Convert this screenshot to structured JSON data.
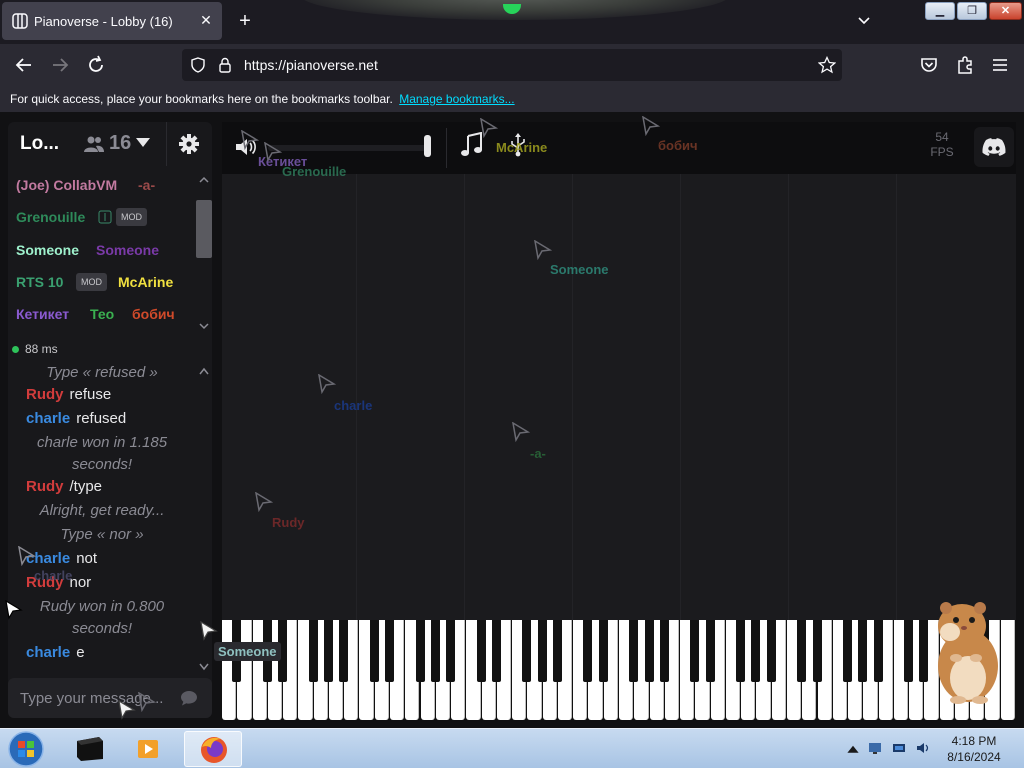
{
  "browser": {
    "tab_title": "Pianoverse - Lobby (16)",
    "url": "https://pianoverse.net",
    "bookmarks_hint": "For quick access, place your bookmarks here on the bookmarks toolbar.",
    "bookmarks_link": "Manage bookmarks..."
  },
  "room": {
    "name": "Lo...",
    "user_count": "16"
  },
  "users": [
    {
      "name": "(Joe) CollabVM",
      "color": "#c27aa0"
    },
    {
      "name": "-a-",
      "color": "#9a4a4a"
    },
    {
      "name": "Grenouille",
      "color": "#2e8a5a",
      "badge": "MOD"
    },
    {
      "name": "Someone",
      "color": "#9ef0cc"
    },
    {
      "name": "Someone",
      "color": "#7a3aa8"
    },
    {
      "name": "RTS 10",
      "color": "#3aa070",
      "badge": "MOD"
    },
    {
      "name": "McArine",
      "color": "#f0e040"
    },
    {
      "name": "Кетикет",
      "color": "#8a5ad0"
    },
    {
      "name": "Тео",
      "color": "#3ab050"
    },
    {
      "name": "бобич",
      "color": "#d04a2a"
    }
  ],
  "ping": "88 ms",
  "chat": [
    {
      "type": "sys",
      "text": "Type « refused »"
    },
    {
      "type": "msg",
      "name": "Rudy",
      "color": "#d23c3c",
      "text": "refuse"
    },
    {
      "type": "msg",
      "name": "charle",
      "color": "#3a8ae0",
      "text": "refused"
    },
    {
      "type": "sys",
      "text": "charle won in 1.185 seconds!"
    },
    {
      "type": "msg",
      "name": "Rudy",
      "color": "#d23c3c",
      "text": "/type"
    },
    {
      "type": "sys",
      "text": "Alright, get ready..."
    },
    {
      "type": "sys",
      "text": "Type « nor »"
    },
    {
      "type": "msg",
      "name": "charle",
      "color": "#3a8ae0",
      "text": "not"
    },
    {
      "type": "msg",
      "name": "Rudy",
      "color": "#d23c3c",
      "text": "nor"
    },
    {
      "type": "sys",
      "text": "Rudy won in 0.800 seconds!"
    },
    {
      "type": "msg",
      "name": "charle",
      "color": "#3a8ae0",
      "text": "e"
    }
  ],
  "chat_input": {
    "placeholder": "Type your message..."
  },
  "fps": {
    "value": "54",
    "label": "FPS"
  },
  "volume_level": 1.0,
  "cursor_labels": [
    {
      "name": "Кетикет",
      "color": "#7a5ab0"
    },
    {
      "name": "Grenouille",
      "color": "#2e7a5a"
    },
    {
      "name": "McArine",
      "color": "#a0a020"
    },
    {
      "name": "бобич",
      "color": "#7a3a28"
    },
    {
      "name": "Someone",
      "color": "#2e8a7a"
    },
    {
      "name": "charle",
      "color": "#1a3a8a"
    },
    {
      "name": "-a-",
      "color": "#2a6a3a"
    },
    {
      "name": "Rudy",
      "color": "#7a2a2a"
    },
    {
      "name": "charle",
      "color": "#4a4a6a"
    },
    {
      "name": "Someone",
      "color": "#8fc1c0"
    }
  ],
  "taskbar": {
    "clock_time": "4:18 PM",
    "clock_date": "8/16/2024"
  }
}
